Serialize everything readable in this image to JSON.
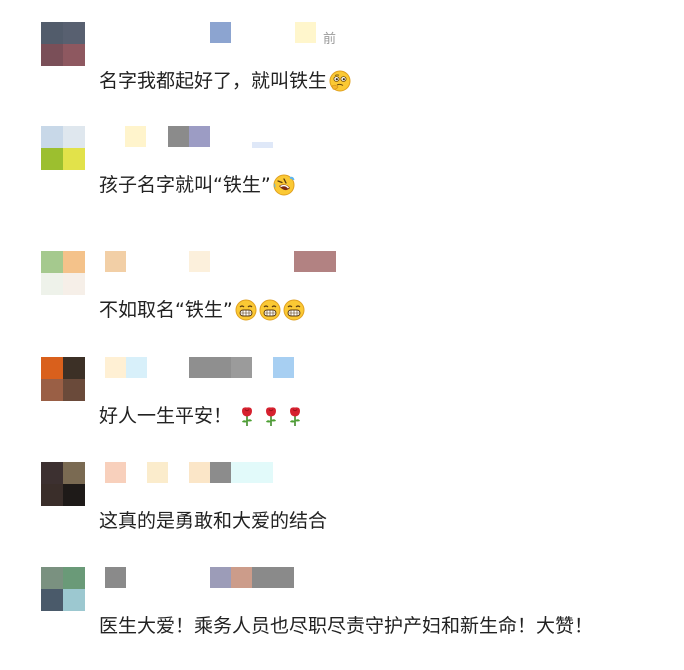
{
  "comments": [
    {
      "text": "名字我都起好了，就叫铁生",
      "time_fragment": "前",
      "emojis": [
        "thinking-face-icon"
      ],
      "avatar_colors": [
        "#525c6b",
        "#586070",
        "#7a4f58",
        "#8e5860"
      ],
      "name_blur_colors": [
        "#8ca4d0",
        "#fff6cc"
      ]
    },
    {
      "text": "孩子名字就叫“铁生”",
      "emojis": [
        "rolling-laughing-icon"
      ],
      "avatar_colors": [
        "#c8d8e8",
        "#dfe7ee",
        "#9cbf2f",
        "#e2e24a"
      ],
      "name_blur_colors": [
        "#fff4cc",
        "#8b8b8b",
        "#9c9cc4",
        "#dfe8f8"
      ]
    },
    {
      "text": "不如取名“铁生”",
      "emojis": [
        "grinning-face-icon",
        "grinning-face-icon",
        "grinning-face-icon"
      ],
      "avatar_colors": [
        "#a5c98e",
        "#f4c28a",
        "#eef2ea",
        "#f6efe8"
      ],
      "name_blur_colors": [
        "#f2cfa6",
        "#fcf0dc",
        "#b28282"
      ]
    },
    {
      "text": "好人一生平安！",
      "emojis": [
        "rose-icon",
        "rose-icon",
        "rose-icon"
      ],
      "avatar_colors": [
        "#d9601c",
        "#3c3026",
        "#9a5f45",
        "#6a4a3a"
      ],
      "name_blur_colors": [
        "#fff0d4",
        "#d8f0fa",
        "#8f8f8f",
        "#9b9b9b",
        "#a7cff2"
      ]
    },
    {
      "text": "这真的是勇敢和大爱的结合",
      "emojis": [],
      "avatar_colors": [
        "#3c3030",
        "#7a6a52",
        "#3a2e2a",
        "#1e1a18"
      ],
      "name_blur_colors": [
        "#f8d0bc",
        "#fbeccc",
        "#fbe6c8",
        "#8c8c8c",
        "#e2fafa"
      ]
    },
    {
      "text": "医生大爱！乘务人员也尽职尽责守护产妇和新生命！大赞！",
      "emojis": [],
      "avatar_colors": [
        "#7a9180",
        "#6a9a78",
        "#4a5a6a",
        "#9cc8d0"
      ],
      "name_blur_colors": [
        "#8a8a8a",
        "#9c9cb8",
        "#cc9c8a",
        "#8a8a8a"
      ]
    }
  ]
}
